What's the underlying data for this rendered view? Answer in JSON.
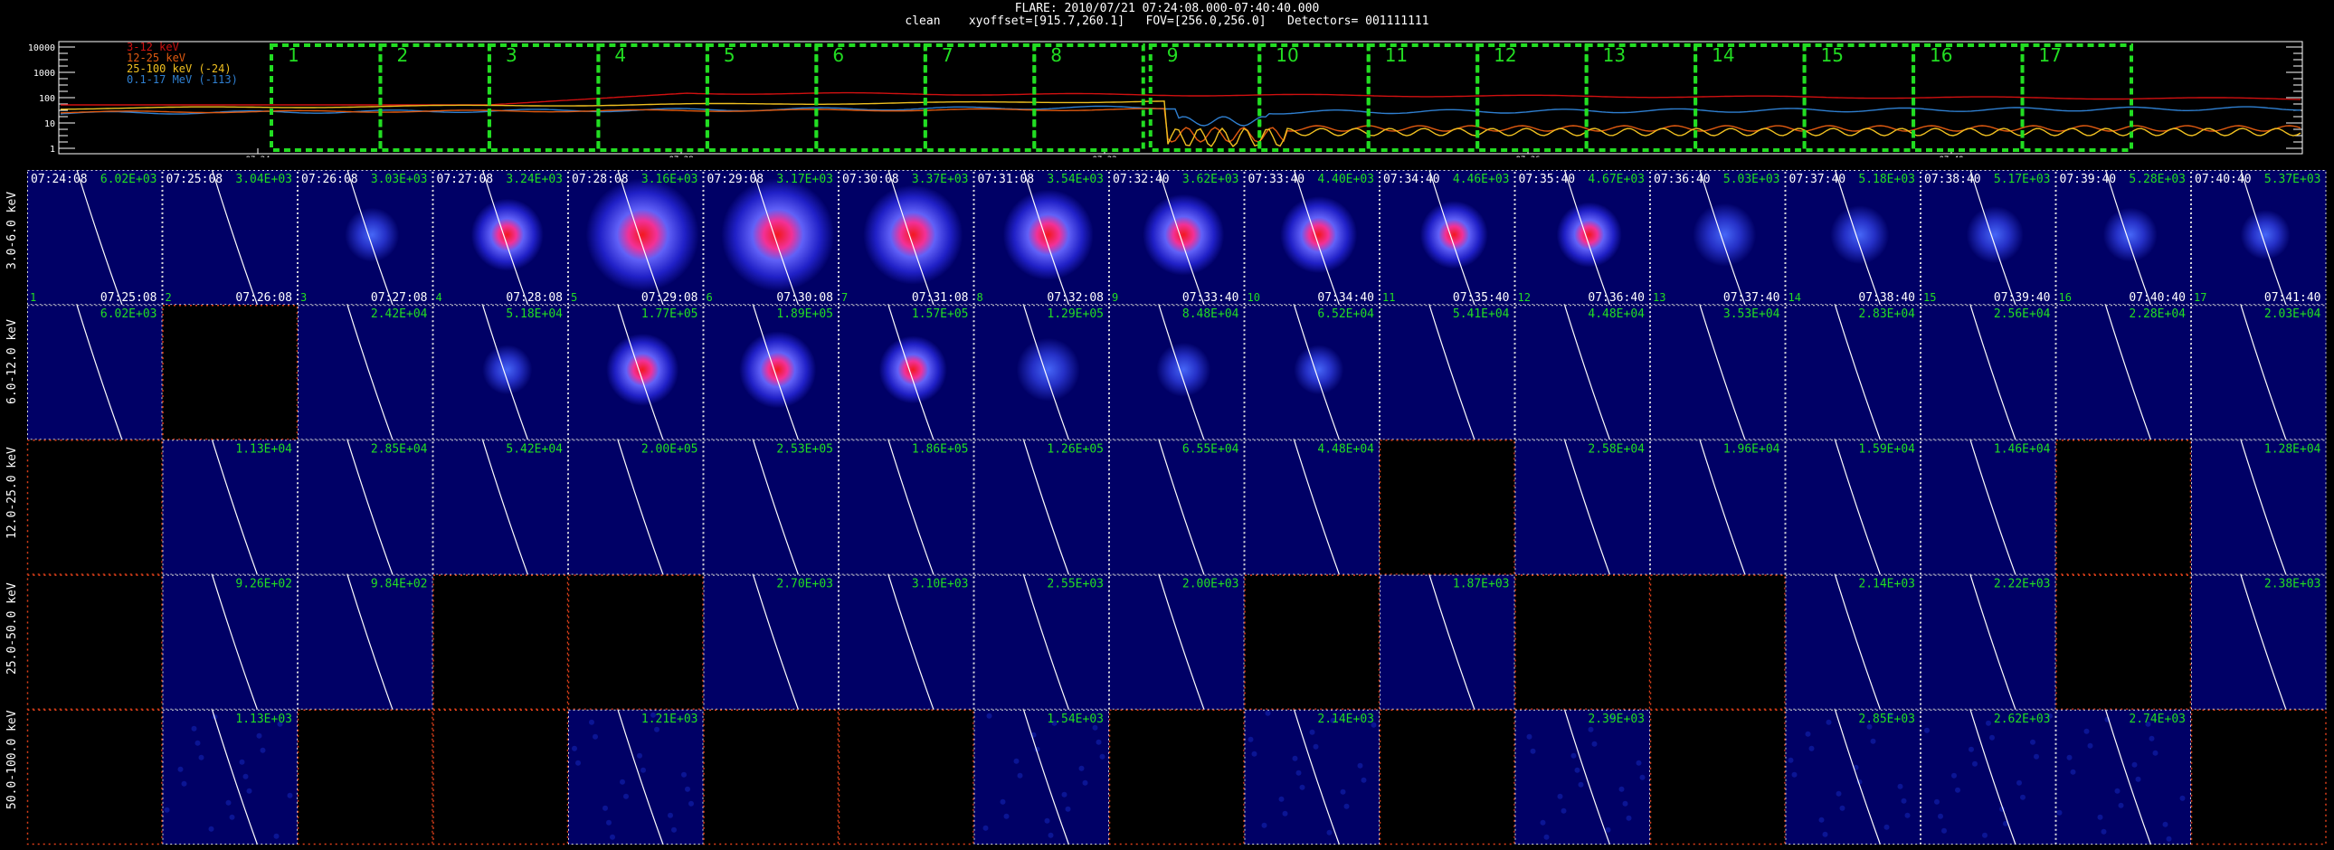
{
  "header": {
    "title": "FLARE: 2010/07/21 07:24:08.000-07:40:40.000",
    "subtitle": "clean    xyoffset=[915.7,260.1]   FOV=[256.0,256.0]   Detectors= 001111111"
  },
  "lightcurve": {
    "yticks": [
      "10000",
      "1000",
      "100",
      "10",
      "1"
    ],
    "xticks": [
      "07:24",
      "07:28",
      "07:32",
      "07:36",
      "07:40"
    ],
    "legend": [
      {
        "label": "3-12 keV",
        "color": "#d01010"
      },
      {
        "label": "12-25 keV",
        "color": "#e05a10"
      },
      {
        "label": "25-100 keV (-24)",
        "color": "#f0c020"
      },
      {
        "label": "0.1-17 MeV (-113)",
        "color": "#2f7fd0"
      }
    ],
    "intervals": [
      "1",
      "2",
      "3",
      "4",
      "5",
      "6",
      "7",
      "8",
      "9",
      "10",
      "11",
      "12",
      "13",
      "14",
      "15",
      "16",
      "17"
    ],
    "accent_interval": "#22dd22"
  },
  "grid": {
    "row_labels": [
      "3.0-6.0 keV",
      "6.0-12.0 keV",
      "12.0-25.0 keV",
      "25.0-50.0 keV",
      "50.0-100.0 keV"
    ],
    "start_times": [
      "07:24:08",
      "07:25:08",
      "07:26:08",
      "07:27:08",
      "07:28:08",
      "07:29:08",
      "07:30:08",
      "07:31:08",
      "07:32:40",
      "07:33:40",
      "07:34:40",
      "07:35:40",
      "07:36:40",
      "07:37:40",
      "07:38:40",
      "07:39:40",
      "07:40:40"
    ],
    "end_times": [
      "07:25:08",
      "07:26:08",
      "07:27:08",
      "07:28:08",
      "07:29:08",
      "07:30:08",
      "07:31:08",
      "07:32:08",
      "07:33:40",
      "07:34:40",
      "07:35:40",
      "07:36:40",
      "07:37:40",
      "07:38:40",
      "07:39:40",
      "07:40:40",
      "07:41:40"
    ],
    "values": [
      [
        "6.02E+03",
        "3.04E+03",
        "3.03E+03",
        "3.24E+03",
        "3.16E+03",
        "3.17E+03",
        "3.37E+03",
        "3.54E+03",
        "3.62E+03",
        "4.40E+03",
        "4.46E+03",
        "4.67E+03",
        "5.03E+03",
        "5.18E+03",
        "5.17E+03",
        "5.28E+03",
        "5.37E+03"
      ],
      [
        "6.02E+03",
        "",
        "2.42E+04",
        "5.18E+04",
        "1.77E+05",
        "1.89E+05",
        "1.57E+05",
        "1.29E+05",
        "8.48E+04",
        "6.52E+04",
        "5.41E+04",
        "4.48E+04",
        "3.53E+04",
        "2.83E+04",
        "2.56E+04",
        "2.28E+04",
        "2.03E+04"
      ],
      [
        "",
        "1.13E+04",
        "2.85E+04",
        "5.42E+04",
        "2.00E+05",
        "2.53E+05",
        "1.86E+05",
        "1.26E+05",
        "6.55E+04",
        "4.48E+04",
        "",
        "2.58E+04",
        "1.96E+04",
        "1.59E+04",
        "1.46E+04",
        "",
        "1.28E+04"
      ],
      [
        "",
        "9.26E+02",
        "9.84E+02",
        "",
        "",
        "2.70E+03",
        "3.10E+03",
        "2.55E+03",
        "2.00E+03",
        "",
        "1.87E+03",
        "",
        "",
        "2.14E+03",
        "2.22E+03",
        "",
        "2.38E+03"
      ],
      [
        "",
        "1.13E+03",
        "",
        "",
        "1.21E+03",
        "",
        "",
        "1.54E+03",
        "",
        "2.14E+03",
        "",
        "2.39E+03",
        "",
        "2.85E+03",
        "2.62E+03",
        "2.74E+03",
        ""
      ]
    ],
    "source_peak": [
      [
        0,
        0,
        0.2,
        0.4,
        0.85,
        0.85,
        0.7,
        0.6,
        0.5,
        0.45,
        0.35,
        0.32,
        0.3,
        0.25,
        0.23,
        0.2,
        0.15
      ],
      [
        0,
        0,
        0,
        0.15,
        0.4,
        0.45,
        0.35,
        0.3,
        0.2,
        0.15,
        0,
        0,
        0,
        0,
        0,
        0,
        0
      ],
      [
        0,
        0,
        0,
        0,
        0,
        0,
        0,
        0,
        0,
        0,
        0,
        0,
        0,
        0,
        0,
        0,
        0
      ],
      [
        0,
        0,
        0,
        0,
        0,
        0,
        0,
        0,
        0,
        0,
        0,
        0,
        0,
        0,
        0,
        0,
        0
      ],
      [
        0,
        0,
        0,
        0,
        0,
        0,
        0,
        0,
        0,
        0,
        0,
        0,
        0,
        0,
        0,
        0,
        0
      ]
    ],
    "colors": {
      "label": "#22dd22",
      "panel": "#000066",
      "frame": "#dddddd",
      "empty_frame": "#e0401a"
    }
  }
}
